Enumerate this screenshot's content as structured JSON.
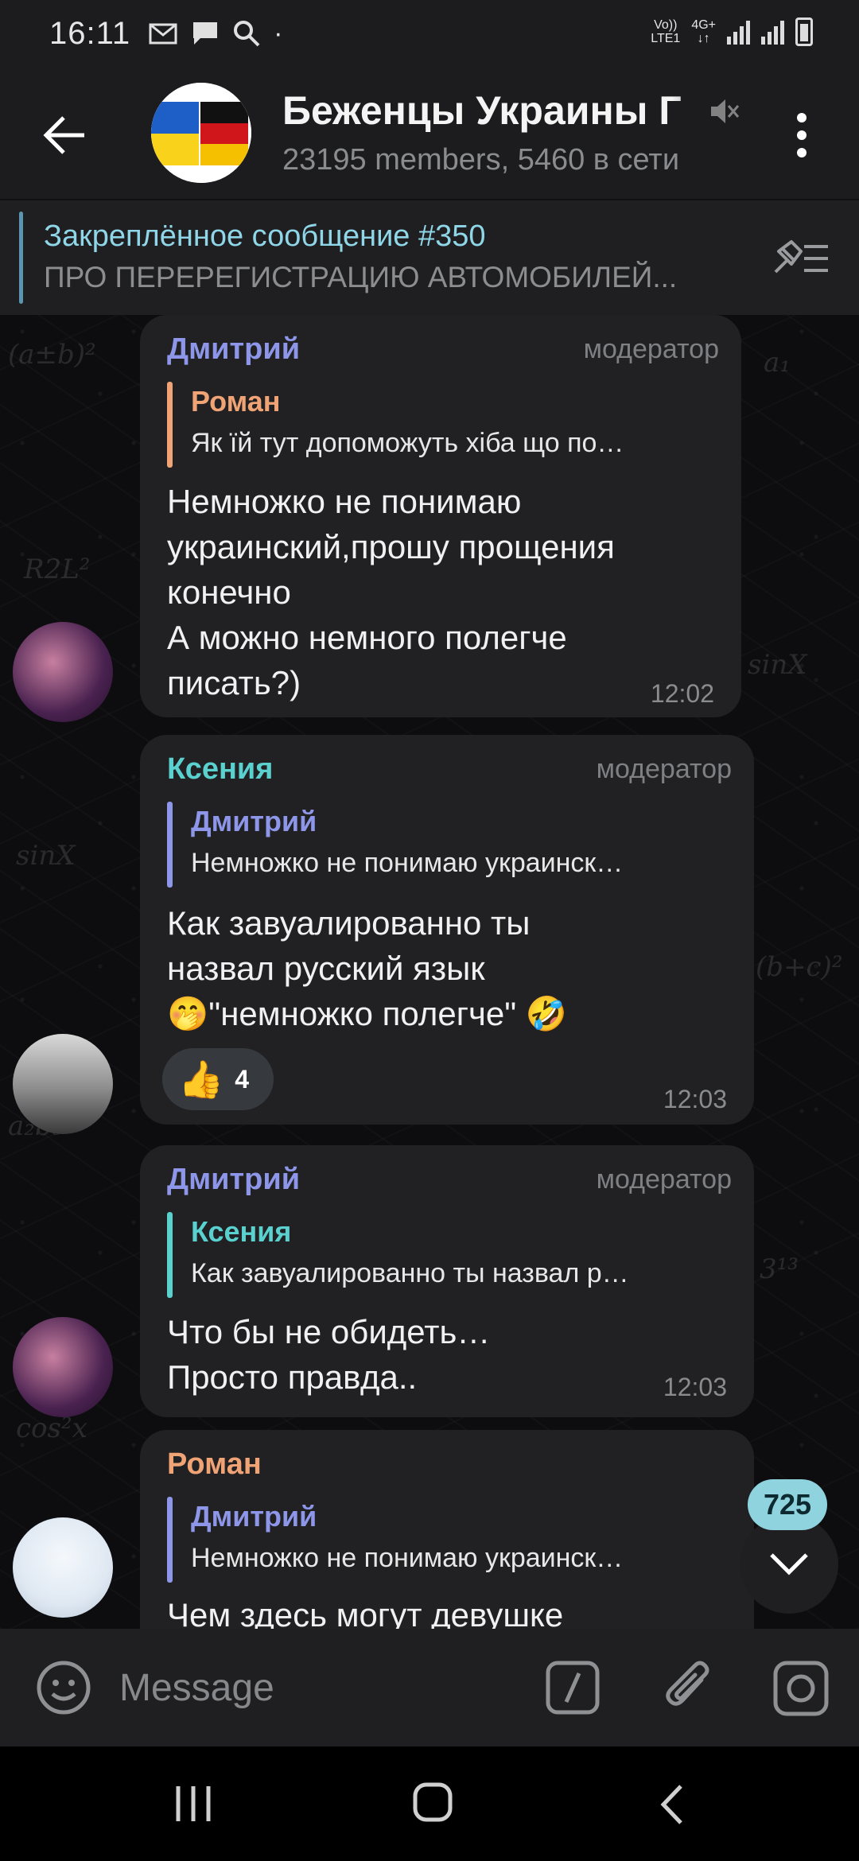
{
  "status_bar": {
    "time": "16:11",
    "network_top": "Vo))",
    "network_bottom": "LTE1",
    "net_type_top": "4G+",
    "dot": "·"
  },
  "header": {
    "title": "Беженцы Украины Г",
    "subtitle": "23195 members, 5460 в сети",
    "avatar_flag_colors": [
      "#1d5fc7",
      "#f8d21b",
      "#111111",
      "#d0161b",
      "#f5c000"
    ]
  },
  "pinned": {
    "title": "Закреплённое сообщение #350",
    "text": "ПРО ПЕРЕРЕГИСТРАЦИЮ АВТОМОБИЛЕЙ..."
  },
  "messages": [
    {
      "sender": "Дмитрий",
      "sender_color": "#8d96e8",
      "role": "модератор",
      "reply_name": "Роман",
      "reply_color": "#f0a476",
      "reply_text": "Як їй тут допоможуть хіба що по…",
      "text": "Немножко не понимаю\nукраинский,прошу прощения\nконечно\nА можно немного полегче\nписать?)",
      "time": "12:02"
    },
    {
      "sender": "Ксения",
      "sender_color": "#5ad0cf",
      "role": "модератор",
      "reply_name": "Дмитрий",
      "reply_color": "#8d96e8",
      "reply_text": "Немножко не понимаю украинск…",
      "text": "Как завуалированно ты\nназвал русский язык\n🤭\"немножко полегче\" 🤣",
      "reaction_emoji": "👍",
      "reaction_count": "4",
      "time": "12:03"
    },
    {
      "sender": "Дмитрий",
      "sender_color": "#8d96e8",
      "role": "модератор",
      "reply_name": "Ксения",
      "reply_color": "#5ad0cf",
      "reply_text": "Как завуалированно ты назвал р…",
      "text": "Что бы не обидеть…\nПросто правда..",
      "time": "12:03"
    },
    {
      "sender": "Роман",
      "sender_color": "#f0a476",
      "reply_name": "Дмитрий",
      "reply_color": "#8d96e8",
      "reply_text": "Немножко не понимаю украинск…",
      "text": "Чем здесь могут девушке"
    }
  ],
  "unread_count": "725",
  "input": {
    "placeholder": "Message"
  }
}
